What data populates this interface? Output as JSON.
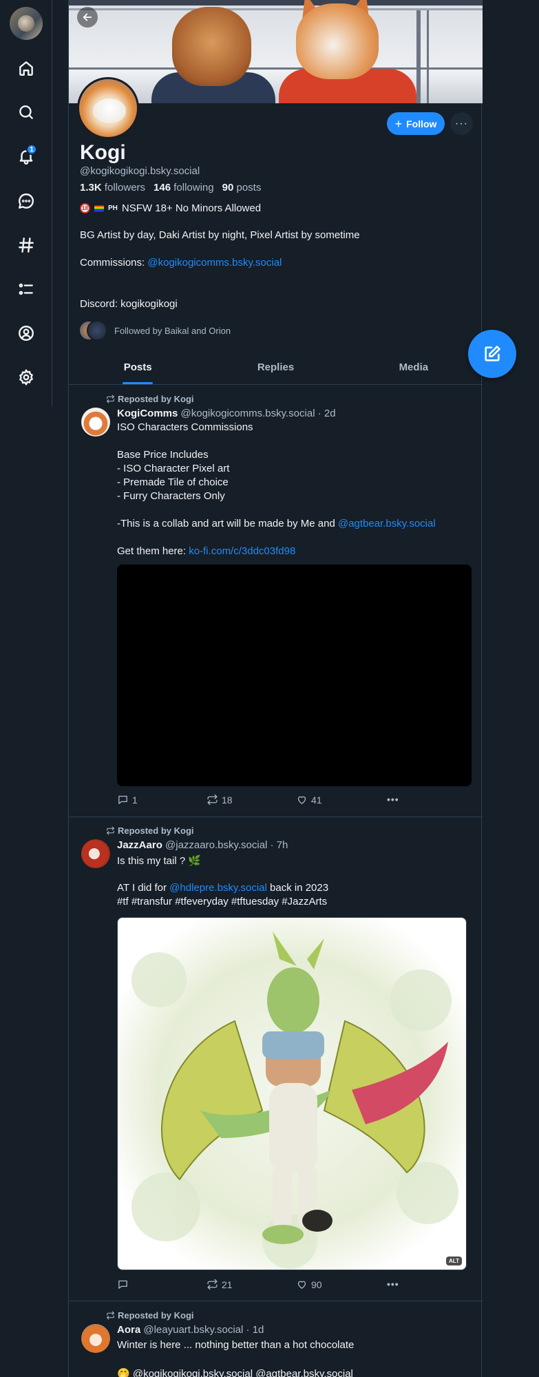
{
  "nav": {
    "notification_count": "1",
    "items": [
      "home",
      "search",
      "notifications",
      "chat",
      "feeds",
      "lists",
      "profile",
      "settings"
    ]
  },
  "profile": {
    "display_name": "Kogi",
    "handle": "@kogikogikogi.bsky.social",
    "followers_count": "1.3K",
    "followers_label": "followers",
    "following_count": "146",
    "following_label": "following",
    "posts_count": "90",
    "posts_label": "posts",
    "badge_text": "NSFW 18+ No Minors Allowed",
    "badge_18": "18",
    "badge_ph": "PH",
    "bio_line1": "BG Artist by day, Daki Artist by night, Pixel Artist by sometime",
    "bio_commissions_label": "Commissions: ",
    "bio_commissions_link": "@kogikogicomms.bsky.social",
    "bio_discord": "Discord: kogikogikogi",
    "followed_by": "Followed by Baikal and Orion",
    "follow_label": "Follow"
  },
  "tabs": [
    {
      "label": "Posts",
      "active": true
    },
    {
      "label": "Replies",
      "active": false
    },
    {
      "label": "Media",
      "active": false
    }
  ],
  "posts": [
    {
      "repost_label": "Reposted by Kogi",
      "author_name": "KogiComms",
      "author_handle": "@kogikogicomms.bsky.social",
      "time": "· 2d",
      "lines": [
        "ISO Characters Commissions",
        "",
        "Base Price Includes",
        "- ISO Character Pixel art",
        "- Premade Tile of choice",
        "- Furry Characters Only",
        "",
        "-This is a collab and art will be made by Me and "
      ],
      "collab_link": "@agtbear.bsky.social",
      "get_label": "Get them here: ",
      "get_link": "ko-fi.com/c/3ddc03fd98",
      "replies": "1",
      "reposts": "18",
      "likes": "41"
    },
    {
      "repost_label": "Reposted by Kogi",
      "author_name": "JazzAaro",
      "author_handle": "@jazzaaro.bsky.social",
      "time": "· 7h",
      "line1": "Is this my tail ? 🌿",
      "line2_prefix": "AT I did for ",
      "line2_link": "@hdlepre.bsky.social",
      "line2_suffix": " back in 2023",
      "tags": "#tf #transfur #tfeveryday #tftuesday #JazzArts",
      "alt": "ALT",
      "replies": "",
      "reposts": "21",
      "likes": "90"
    },
    {
      "repost_label": "Reposted by Kogi",
      "author_name": "Aora",
      "author_handle": "@leayuart.bsky.social",
      "time": "· 1d",
      "line1": "Winter is here ... nothing better than a hot chocolate",
      "mentions": "🤭 @kogikogikogi.bsky.social @agtbear.bsky.social"
    }
  ],
  "colors": {
    "background": "#161e27",
    "accent": "#208bfe",
    "muted_text": "#aebbc9",
    "border": "#2e4052"
  }
}
